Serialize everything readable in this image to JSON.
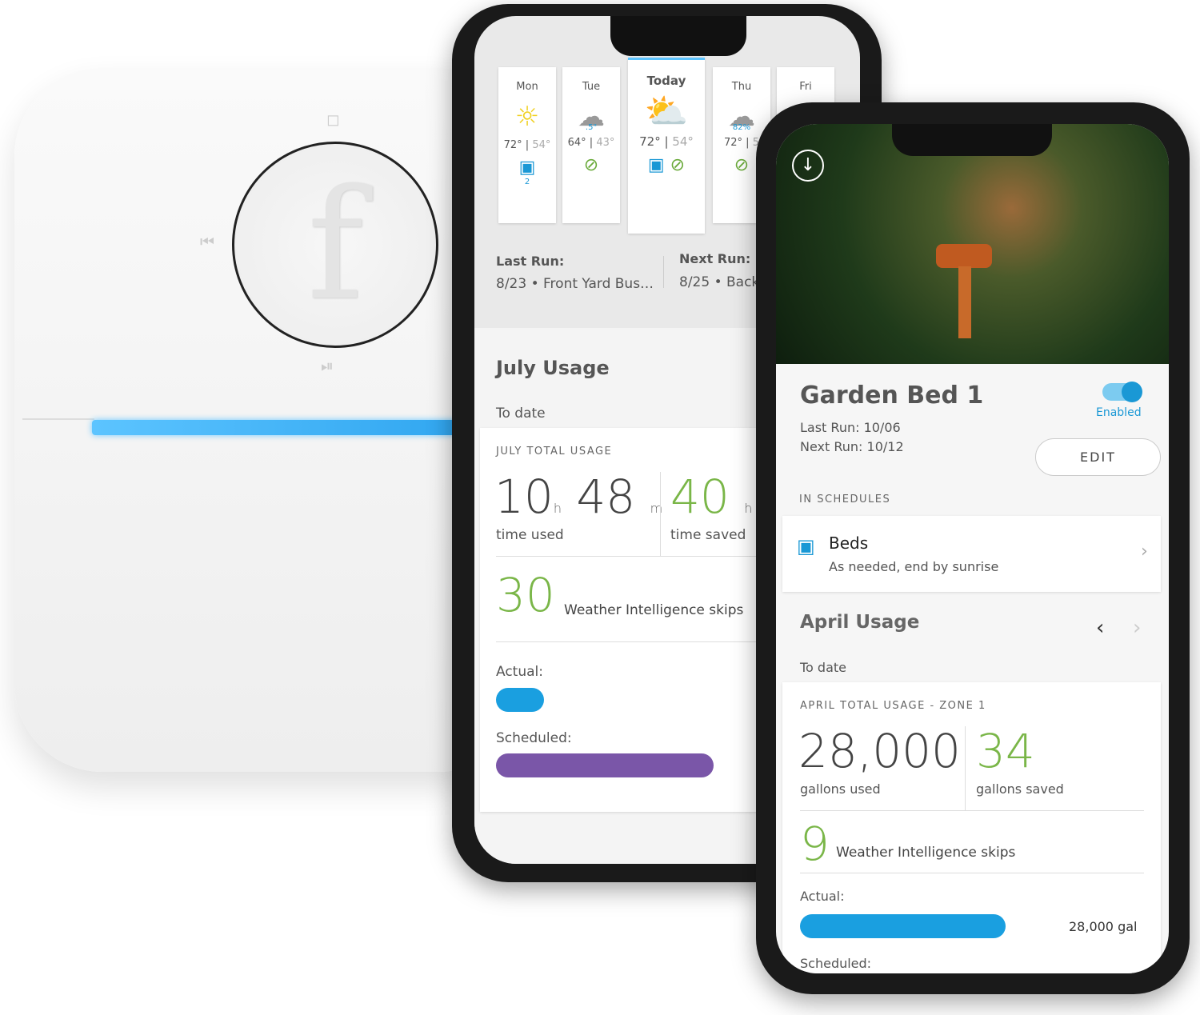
{
  "colors": {
    "accent_blue": "#1a98d5",
    "green": "#7ab648",
    "purple": "#7a56a8",
    "light_strip": "#40b0f5"
  },
  "controller": {
    "logo": "f"
  },
  "phone1": {
    "forecast": [
      {
        "day": "Mon",
        "icon": "sun-icon",
        "precip": "",
        "high": "72°",
        "low": "54°",
        "action": "watering-icon",
        "action_count": "2"
      },
      {
        "day": "Tue",
        "icon": "rain-icon",
        "precip": ".5\"",
        "high": "64°",
        "low": "43°",
        "action": "skip-icon",
        "action_count": ""
      },
      {
        "day": "Today",
        "icon": "partly-cloudy-icon",
        "precip": "",
        "high": "72°",
        "low": "54°",
        "action": "watering-and-skip-icon",
        "action_count": ""
      },
      {
        "day": "Thu",
        "icon": "rain-icon",
        "precip": "82%",
        "high": "72°",
        "low": "5",
        "action": "skip-icon",
        "action_count": ""
      },
      {
        "day": "Fri",
        "icon": "",
        "precip": "",
        "high": "",
        "low": "",
        "action": "",
        "action_count": ""
      }
    ],
    "partial_prev_temp": "3°",
    "last_run": {
      "label": "Last Run:",
      "value": "8/23 • Front Yard Bus…"
    },
    "next_run": {
      "label": "Next Run:",
      "value": "8/25 • Back"
    },
    "usage_title": "July Usage",
    "to_date": "To date",
    "total_label": "JULY TOTAL USAGE",
    "hours": "10",
    "hours_unit": "h",
    "minutes": "48",
    "minutes_unit": "m",
    "time_used": "time used",
    "saved": "40",
    "saved_unit": "h",
    "time_saved": "time saved",
    "skips": "30",
    "skips_label": "Weather Intelligence skips",
    "actual_label": "Actual:",
    "scheduled_label": "Scheduled:",
    "actual_fraction": 0.22,
    "scheduled_fraction": 1.0
  },
  "phone2": {
    "zone_name": "Garden Bed 1",
    "last_run": "Last Run: 10/06",
    "next_run": "Next Run: 10/12",
    "enabled": true,
    "enabled_label": "Enabled",
    "edit_label": "EDIT",
    "in_schedules": "IN SCHEDULES",
    "schedule": {
      "name": "Beds",
      "desc": "As needed, end by sunrise"
    },
    "usage_title": "April Usage",
    "to_date": "To date",
    "total_label": "APRIL TOTAL USAGE - ZONE 1",
    "gallons_used": "28,000",
    "gallons_used_label": "gallons used",
    "gallons_saved": "34",
    "gallons_saved_label": "gallons saved",
    "skips": "9",
    "skips_label": "Weather Intelligence skips",
    "actual_label": "Actual:",
    "actual_value": "28,000 gal",
    "actual_fraction": 1.0,
    "scheduled_label": "Scheduled:"
  }
}
